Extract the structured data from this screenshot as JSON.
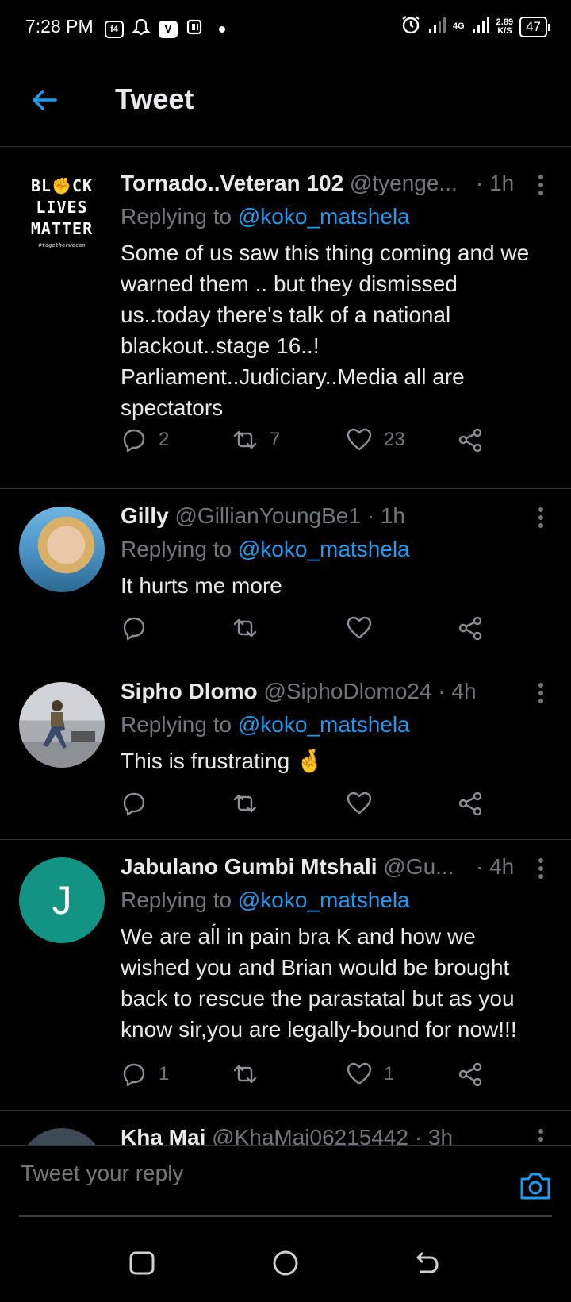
{
  "status_bar": {
    "time": "7:28 PM",
    "badges": [
      "f4",
      "V"
    ],
    "network": "4G",
    "speed": "2.89",
    "speed_unit": "K/S",
    "battery": "47"
  },
  "header": {
    "title": "Tweet"
  },
  "colors": {
    "accent": "#1d9bf0",
    "muted": "#71767b",
    "divider": "#2f3336",
    "jabulano_avatar": "#139483"
  },
  "tweets": [
    {
      "name": "Tornado..Veteran 102",
      "handle": "@tyenge...",
      "time": "· 1h",
      "replying_label": "Replying to",
      "replying_to": "@koko_matshela",
      "text": "Some of us saw this thing coming and we warned them .. but they dismissed us..today there's talk of a national blackout..stage 16..! Parliament..Judiciary..Media all are spectators",
      "avatar_lines": [
        "BL✊CK",
        "LIVES",
        "MATTER",
        "#togetherwecan"
      ],
      "replies": "2",
      "retweets": "7",
      "likes": "23"
    },
    {
      "name": "Gilly",
      "handle": "@GillianYoungBe1",
      "time": "· 1h",
      "replying_label": "Replying to",
      "replying_to": "@koko_matshela",
      "text": "It hurts me more",
      "replies": "",
      "retweets": "",
      "likes": ""
    },
    {
      "name": "Sipho Dlomo",
      "handle": "@SiphoDlomo24",
      "time": "· 4h",
      "replying_label": "Replying to",
      "replying_to": "@koko_matshela",
      "text": "This is frustrating 🤞",
      "replies": "",
      "retweets": "",
      "likes": ""
    },
    {
      "name": "Jabulano Gumbi Mtshali",
      "handle": "@Gu...",
      "time": "· 4h",
      "replying_label": "Replying to",
      "replying_to": "@koko_matshela",
      "text": "We are aĺl in pain bra K and how we wished you and Brian would be brought back to rescue the parastatal but as you know sir,you are legally-bound for now!!!",
      "avatar_letter": "J",
      "replies": "1",
      "retweets": "",
      "likes": "1"
    },
    {
      "name": "Kha Mai",
      "handle": "@KhaMai06215442",
      "time": "· 3h"
    }
  ],
  "compose": {
    "placeholder": "Tweet your reply"
  }
}
